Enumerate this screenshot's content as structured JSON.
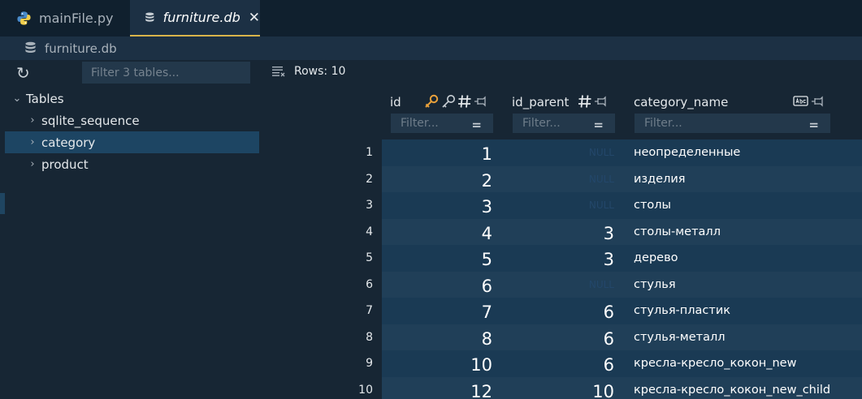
{
  "tabs": [
    {
      "label": "mainFile.py",
      "icon": "python-icon",
      "active": false
    },
    {
      "label": "furniture.db",
      "icon": "database-icon",
      "active": true,
      "close": "✕"
    }
  ],
  "breadcrumb": {
    "label": "furniture.db",
    "icon": "database-icon"
  },
  "sidebar": {
    "refresh_icon": "↻",
    "filter_placeholder": "Filter 3 tables...",
    "tree": {
      "root_label": "Tables",
      "items": [
        {
          "label": "sqlite_sequence"
        },
        {
          "label": "category",
          "selected": true
        },
        {
          "label": "product"
        }
      ]
    }
  },
  "grid": {
    "rows_label": "Rows: 10",
    "columns": [
      {
        "name": "id",
        "filter_placeholder": "Filter...",
        "icons": [
          "key-icon",
          "foreign-key-icon",
          "number-type-icon",
          "pin-icon"
        ]
      },
      {
        "name": "id_parent",
        "filter_placeholder": "Filter...",
        "icons": [
          "number-type-icon",
          "pin-icon"
        ]
      },
      {
        "name": "category_name",
        "filter_placeholder": "Filter...",
        "icons": [
          "text-type-icon",
          "pin-icon"
        ]
      }
    ],
    "filter_menu_glyph": "=",
    "null_text": "NULL",
    "rows": [
      {
        "num": "1",
        "id": "1",
        "id_parent": "NULL",
        "category_name": "неопределенные"
      },
      {
        "num": "2",
        "id": "2",
        "id_parent": "NULL",
        "category_name": "изделия"
      },
      {
        "num": "3",
        "id": "3",
        "id_parent": "NULL",
        "category_name": "столы"
      },
      {
        "num": "4",
        "id": "4",
        "id_parent": "3",
        "category_name": "столы-металл"
      },
      {
        "num": "5",
        "id": "5",
        "id_parent": "3",
        "category_name": "дерево"
      },
      {
        "num": "6",
        "id": "6",
        "id_parent": "NULL",
        "category_name": "стулья"
      },
      {
        "num": "7",
        "id": "7",
        "id_parent": "6",
        "category_name": "стулья-пластик"
      },
      {
        "num": "8",
        "id": "8",
        "id_parent": "6",
        "category_name": "стулья-металл"
      },
      {
        "num": "9",
        "id": "10",
        "id_parent": "6",
        "category_name": "кресла-кресло_кокон_new"
      },
      {
        "num": "10",
        "id": "12",
        "id_parent": "10",
        "category_name": "кресла-кресло_кокон_new_child"
      }
    ]
  },
  "colors": {
    "accent_tab_border": "#d9b44a",
    "key_icon": "#e9a13b",
    "row_odd": "#1a3a54",
    "row_even": "#203f58"
  }
}
